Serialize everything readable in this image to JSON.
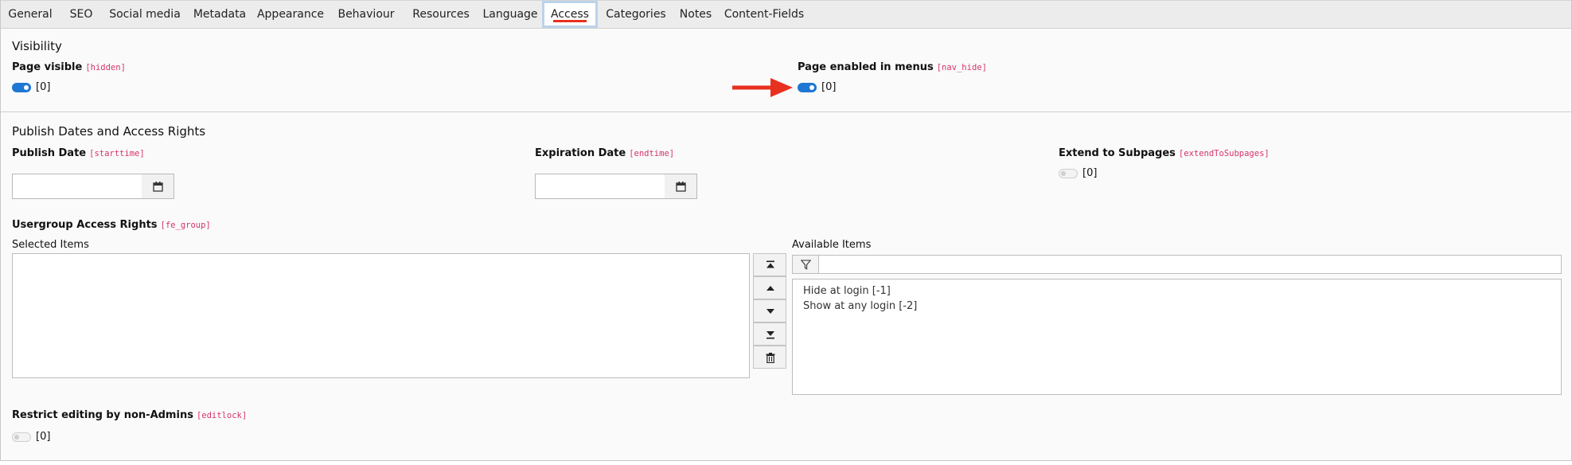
{
  "tabs": [
    {
      "label": "General",
      "active": false
    },
    {
      "label": "SEO",
      "active": false
    },
    {
      "label": "Social media",
      "active": false
    },
    {
      "label": "Metadata",
      "active": false
    },
    {
      "label": "Appearance",
      "active": false
    },
    {
      "label": "Behaviour",
      "active": false
    },
    {
      "label": "Resources",
      "active": false
    },
    {
      "label": "Language",
      "active": false
    },
    {
      "label": "Access",
      "active": true
    },
    {
      "label": "Categories",
      "active": false
    },
    {
      "label": "Notes",
      "active": false
    },
    {
      "label": "Content-Fields",
      "active": false
    }
  ],
  "visibility": {
    "title": "Visibility",
    "page_visible": {
      "label": "Page visible",
      "field": "[hidden]",
      "enabled": true,
      "value": "[0]"
    },
    "page_enabled_menus": {
      "label": "Page enabled in menus",
      "field": "[nav_hide]",
      "enabled": true,
      "value": "[0]"
    }
  },
  "publish": {
    "title": "Publish Dates and Access Rights",
    "publish_date": {
      "label": "Publish Date",
      "field": "[starttime]",
      "value": ""
    },
    "expiration_date": {
      "label": "Expiration Date",
      "field": "[endtime]",
      "value": ""
    },
    "extend": {
      "label": "Extend to Subpages",
      "field": "[extendToSubpages]",
      "enabled": false,
      "value": "[0]"
    },
    "usergroup": {
      "label": "Usergroup Access Rights",
      "field": "[fe_group]",
      "selected_label": "Selected Items",
      "available_label": "Available Items",
      "filter_value": "",
      "available_items": [
        "Hide at login [-1]",
        "Show at any login [-2]"
      ]
    },
    "editlock": {
      "label": "Restrict editing by non-Admins",
      "field": "[editlock]",
      "enabled": false,
      "value": "[0]"
    }
  },
  "icons": {
    "calendar": "calendar-icon",
    "filter": "filter-icon",
    "move_top": "move-to-top-icon",
    "move_up": "move-up-icon",
    "move_down": "move-down-icon",
    "move_bottom": "move-to-bottom-icon",
    "delete": "trash-icon",
    "annotation": "red-arrow-icon"
  },
  "colors": {
    "toggle_on": "#1e77d3",
    "field_code": "#d6336c",
    "active_tab_underline": "#e8301f",
    "annotation_arrow": "#e8301f"
  }
}
